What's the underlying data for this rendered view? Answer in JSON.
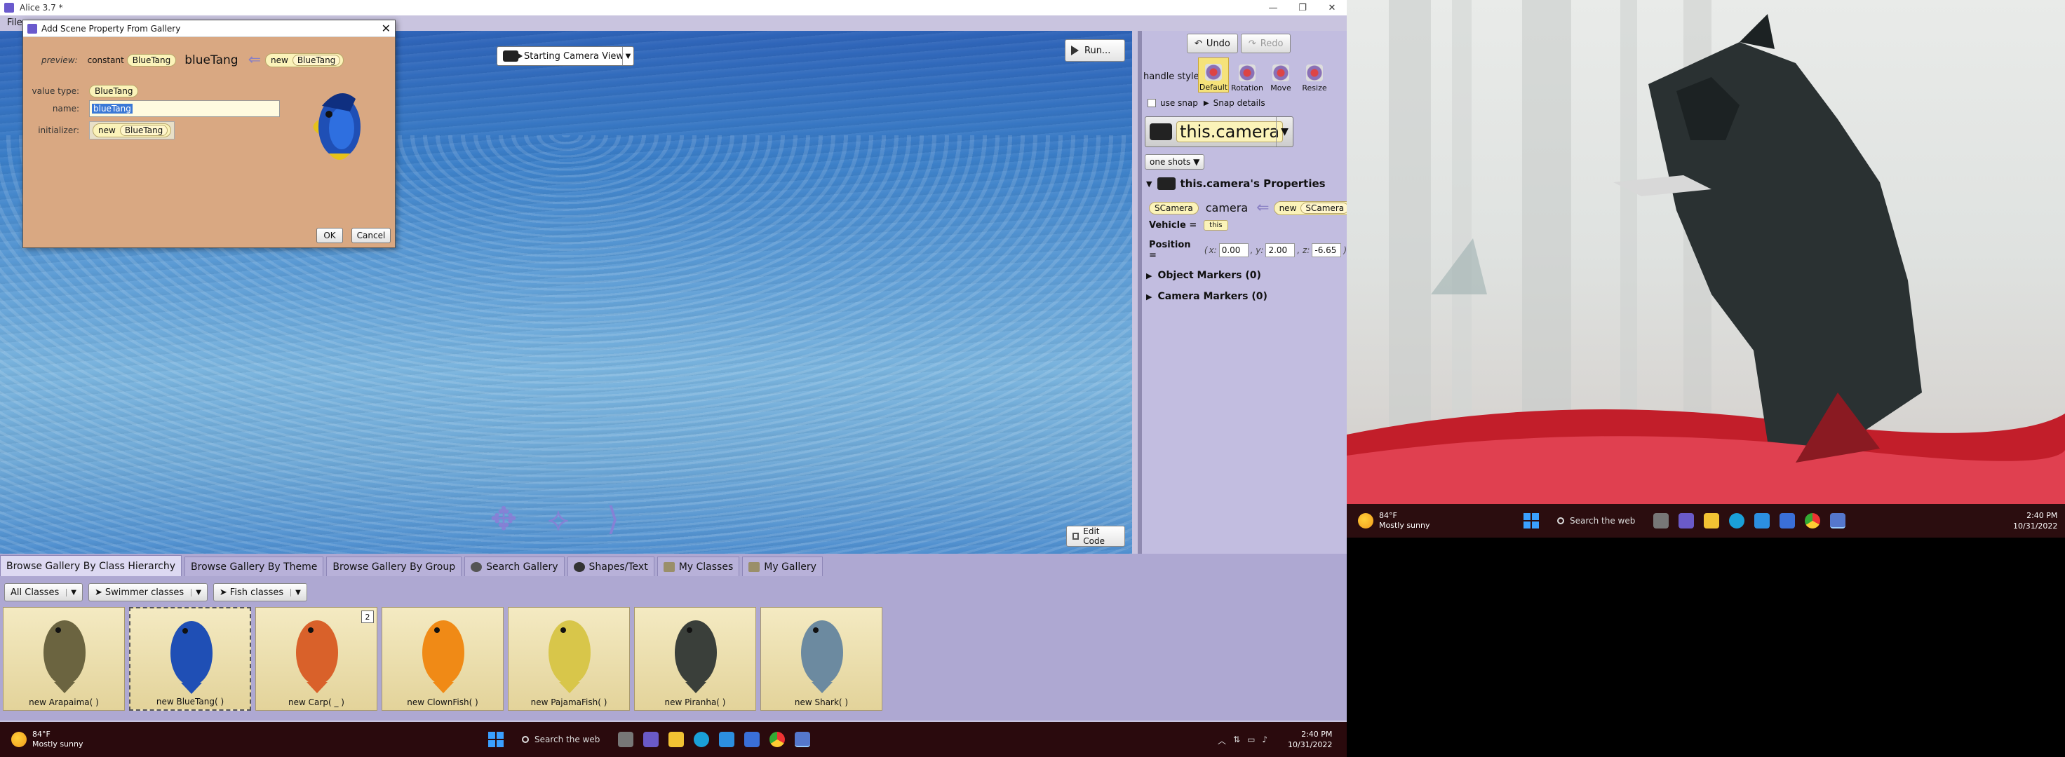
{
  "window": {
    "title": "Alice 3.7 *",
    "controls": [
      "—",
      "❐",
      "✕"
    ],
    "menu": [
      "File"
    ]
  },
  "scene": {
    "camera_view": "Starting Camera View",
    "run_label": "Run...",
    "edit_code_label": "Edit Code"
  },
  "dialog": {
    "title": "Add Scene Property From Gallery",
    "preview_label": "preview:",
    "preview_constant": "constant",
    "preview_type": "BlueTang",
    "preview_name": "blueTang",
    "preview_new": "new",
    "preview_new_type": "BlueTang",
    "value_type_label": "value type:",
    "value_type": "BlueTang",
    "name_label": "name:",
    "name_value": "blueTang",
    "initializer_label": "initializer:",
    "init_new": "new",
    "init_type": "BlueTang",
    "ok": "OK",
    "cancel": "Cancel"
  },
  "props": {
    "undo": "Undo",
    "redo": "Redo",
    "handle_style_label": "handle style:",
    "handles": [
      "Default",
      "Rotation",
      "Move",
      "Resize"
    ],
    "use_snap": "use snap",
    "snap_details": "Snap details",
    "selected_object": "this.camera",
    "one_shots": "one shots ▼",
    "properties_title": "this.camera's Properties",
    "type_pill": "SCamera",
    "object_name": "camera",
    "new_label": "new",
    "new_type": "SCamera",
    "vehicle_label": "Vehicle =",
    "vehicle_value": "this",
    "position_label": "Position =",
    "pos_open": "(",
    "x_label": "x:",
    "x": "0.00",
    "y_label": ", y:",
    "y": "2.00",
    "z_label": ", z:",
    "z": "-6.65",
    "pos_close": ")",
    "object_markers": "Object Markers (0)",
    "camera_markers": "Camera Markers (0)"
  },
  "gallery": {
    "tabs": [
      "Browse Gallery By Class Hierarchy",
      "Browse Gallery By Theme",
      "Browse Gallery By Group",
      "Search Gallery",
      "Shapes/Text",
      "My Classes",
      "My Gallery"
    ],
    "crumbs": [
      "All Classes",
      "Swimmer classes",
      "Fish classes"
    ],
    "fish": [
      {
        "name": "new Arapaima( )",
        "color": "#6b6440"
      },
      {
        "name": "new BlueTang( )",
        "color": "#1f4fb5"
      },
      {
        "name": "new Carp( _ )",
        "color": "#d9612a",
        "badge": "2"
      },
      {
        "name": "new ClownFish( )",
        "color": "#f08a16"
      },
      {
        "name": "new PajamaFish( )",
        "color": "#d8c64a"
      },
      {
        "name": "new Piranha( )",
        "color": "#3a3f3a"
      },
      {
        "name": "new Shark( )",
        "color": "#6c8aa0"
      }
    ]
  },
  "taskbar": {
    "temp": "84°F",
    "condition": "Mostly sunny",
    "search": "Search the web",
    "time": "2:40 PM",
    "date": "10/31/2022"
  }
}
